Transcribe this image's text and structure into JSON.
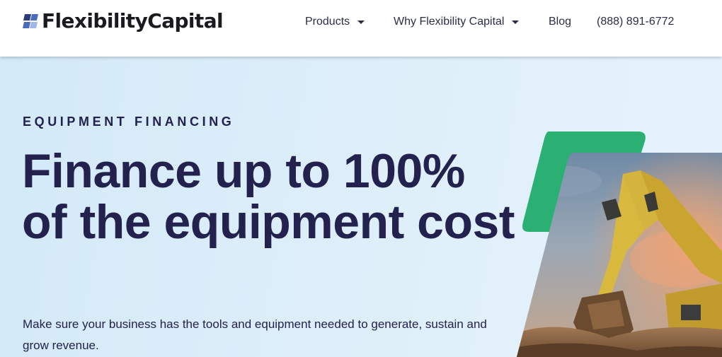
{
  "brand": {
    "name": "FlexibilityCapital",
    "colors": {
      "navy": "#23214e",
      "green": "#2bb074",
      "logo_blue": "#3a5aa8"
    }
  },
  "nav": {
    "products": "Products",
    "why": "Why Flexibility Capital",
    "blog": "Blog",
    "phone": "(888) 891-6772"
  },
  "hero": {
    "eyebrow": "EQUIPMENT FINANCING",
    "headline": "Finance up to 100% of the equipment cost",
    "subtext": "Make sure your business has the tools and equipment needed to generate, sustain and grow revenue."
  },
  "icons": [
    "logo-mark-icon",
    "chevron-down-icon",
    "excavator-photo"
  ]
}
